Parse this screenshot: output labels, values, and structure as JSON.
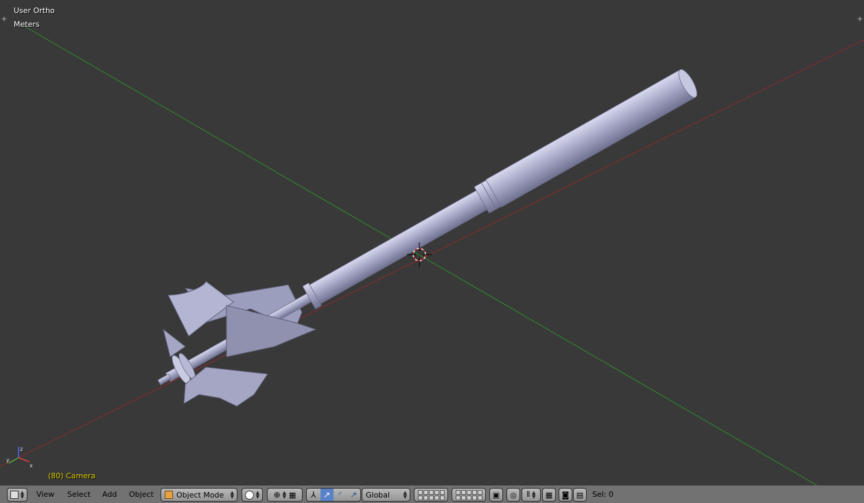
{
  "viewport": {
    "view_name": "User Ortho",
    "units": "Meters",
    "frame_info": "(80) Camera"
  },
  "header": {
    "menus": [
      "View",
      "Select",
      "Add",
      "Object"
    ],
    "mode": "Object Mode",
    "orientation": "Global",
    "selection": "Sel: 0"
  },
  "colors": {
    "viewport_bg": "#393939",
    "header_bg": "#727272",
    "x_axis": "#a02828",
    "y_axis": "#2e8f2e",
    "object_fill": "#a9abc9",
    "frame_text": "#e4d300",
    "active_blue": "#5a82c8"
  },
  "icons": {
    "editor_type": "cube-icon",
    "mode": "object-cube-icon",
    "shading": "solid-sphere-icon",
    "pivot": "pivot-point-icon",
    "manipulator": "manipulator-icon",
    "translate": "translate-arrow-icon",
    "rotate": "rotate-arc-icon",
    "scale": "scale-arrow-icon",
    "proportional": "proportional-edit-icon",
    "snap": "snap-magnet-icon",
    "render": "camera-render-icon",
    "anim_render": "clapper-icon"
  }
}
